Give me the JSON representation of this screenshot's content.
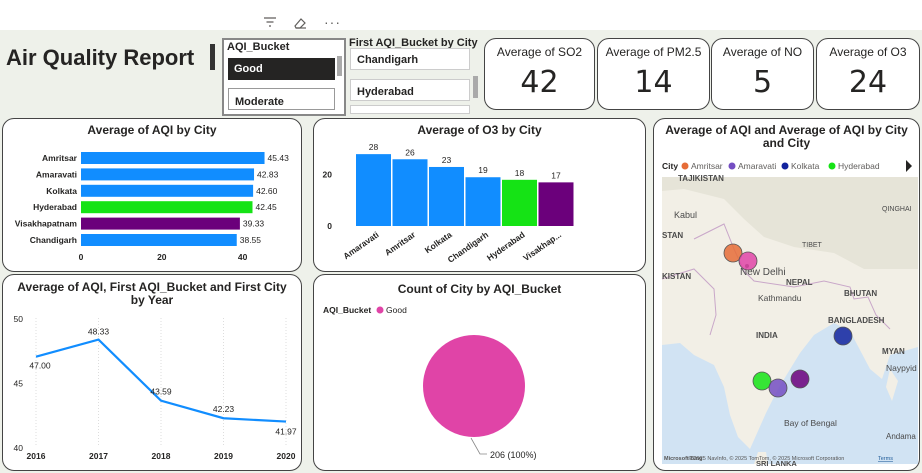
{
  "report": {
    "title": "Air Quality Report"
  },
  "toolbar": {
    "filter_icon": "filter-icon",
    "eraser_icon": "eraser-icon",
    "more_icon": "more-options-icon"
  },
  "slicer_bucket": {
    "title": "AQI_Bucket",
    "items": [
      "Good",
      "Moderate"
    ],
    "selected": "Good"
  },
  "slicer_city": {
    "title": "First AQI_Bucket by City",
    "items": [
      "Chandigarh",
      "Hyderabad"
    ]
  },
  "kpis": [
    {
      "title": "Average of SO2",
      "value": "42"
    },
    {
      "title": "Average of PM2.5",
      "value": "14"
    },
    {
      "title": "Average of NO",
      "value": "5"
    },
    {
      "title": "Average of O3",
      "value": "24"
    }
  ],
  "colors": {
    "blue": "#118dff",
    "green": "#1aab40",
    "purple": "#6b007b",
    "lime": "#15e315",
    "pink": "#e044a7",
    "orange": "#e66c37",
    "lavender": "#744ec2",
    "navy": "#12239e",
    "line": "#118dff"
  },
  "chart_data": [
    {
      "type": "bar",
      "orientation": "horizontal",
      "title": "Average of AQI by City",
      "categories": [
        "Amritsar",
        "Amaravati",
        "Kolkata",
        "Hyderabad",
        "Visakhapatnam",
        "Chandigarh"
      ],
      "values": [
        45.43,
        42.83,
        42.6,
        42.45,
        39.33,
        38.55
      ],
      "labels": [
        "45.43",
        "42.83",
        "42.60",
        "42.45",
        "39.33",
        "38.55"
      ],
      "bar_colors": [
        "#118dff",
        "#118dff",
        "#118dff",
        "#15e315",
        "#6b007b",
        "#118dff"
      ],
      "x_ticks": [
        "0",
        "20",
        "40"
      ],
      "xlim": [
        0,
        50
      ]
    },
    {
      "type": "bar",
      "title": "Average of O3 by City",
      "categories": [
        "Amaravati",
        "Amritsar",
        "Kolkata",
        "Chandigarh",
        "Hyderabad",
        "Visakhap..."
      ],
      "values": [
        28,
        26,
        23,
        19,
        18,
        17
      ],
      "labels": [
        "28",
        "26",
        "23",
        "19",
        "18",
        "17"
      ],
      "bar_colors": [
        "#118dff",
        "#118dff",
        "#118dff",
        "#118dff",
        "#15e315",
        "#6b007b"
      ],
      "y_ticks": [
        "0",
        "20"
      ],
      "ylim": [
        0,
        30
      ]
    },
    {
      "type": "line",
      "title": "Average of AQI, First AQI_Bucket and First City by Year",
      "x": [
        "2016",
        "2017",
        "2018",
        "2019",
        "2020"
      ],
      "values": [
        47.0,
        48.33,
        43.59,
        42.23,
        41.97
      ],
      "labels": [
        "47.00",
        "48.33",
        "43.59",
        "42.23",
        "41.97"
      ],
      "y_ticks": [
        "40",
        "45",
        "50"
      ],
      "ylim": [
        40,
        50
      ]
    },
    {
      "type": "pie",
      "title": "Count of City by AQI_Bucket",
      "legend_title": "AQI_Bucket",
      "legend": [
        "Good"
      ],
      "slices": [
        {
          "name": "Good",
          "value": 206,
          "label": "206 (100%)"
        }
      ]
    },
    {
      "type": "map",
      "title": "Average of AQI and Average of AQI by City and City",
      "legend_title": "City",
      "legend": [
        "Amritsar",
        "Amaravati",
        "Kolkata",
        "Hyderabad"
      ],
      "legend_colors": [
        "#e66c37",
        "#744ec2",
        "#12239e",
        "#15e315"
      ],
      "place_labels": [
        "TAJIKISTAN",
        "Kabul",
        "STAN",
        "KISTAN",
        "New Delhi",
        "TIBET",
        "NEPAL",
        "Kathmandu",
        "BHUTAN",
        "QINGHAI",
        "INDIA",
        "BANGLADESH",
        "MYAN",
        "Naypyid",
        "Bay of Bengal",
        "Andama",
        "SRI LANKA"
      ],
      "attribution": "© 2025 NavInfo, © 2025 TomTom, © 2025 Microsoft Corporation",
      "terms": "Terms",
      "provider": "Microsoft Bing"
    }
  ]
}
